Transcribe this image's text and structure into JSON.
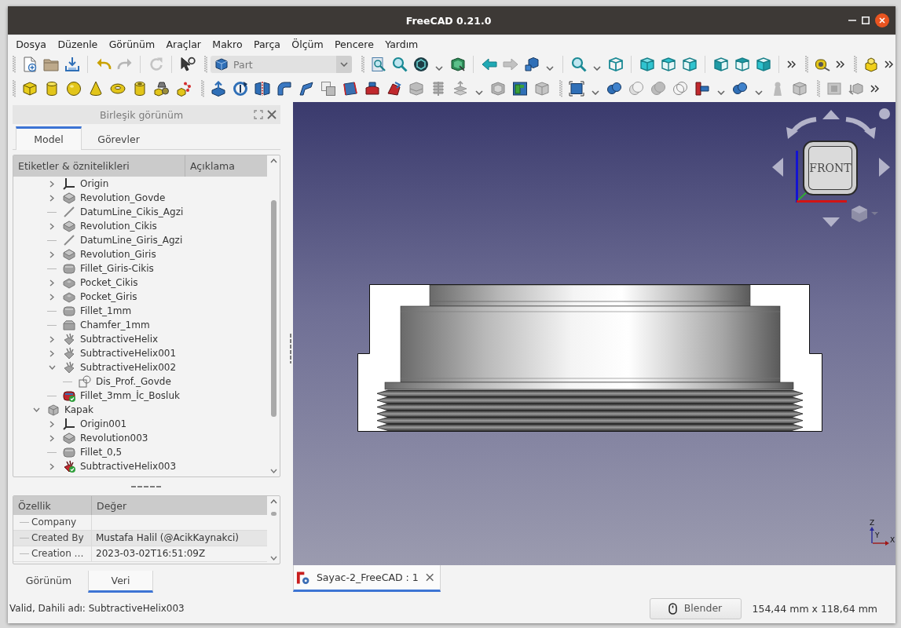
{
  "window": {
    "title": "FreeCAD 0.21.0"
  },
  "menu": [
    "Dosya",
    "Düzenle",
    "Görünüm",
    "Araçlar",
    "Makro",
    "Parça",
    "Ölçüm",
    "Pencere",
    "Yardım"
  ],
  "toolbar": {
    "workbench": "Part"
  },
  "combo_view": {
    "title": "Birleşik görünüm",
    "tabs": [
      {
        "label": "Model",
        "selected": true
      },
      {
        "label": "Görevler",
        "selected": false
      }
    ]
  },
  "tree": {
    "columns": [
      "Etiketler & öznitelikleri",
      "Açıklama"
    ],
    "items": [
      {
        "children": [
          {
            "label": "Origin",
            "kind": "origin",
            "expanded": false
          },
          {
            "label": "Revolution_Govde",
            "kind": "revolution",
            "expanded": false,
            "visible": false
          },
          {
            "label": "DatumLine_Cikis_Agzi",
            "kind": "datumline",
            "visible": false
          },
          {
            "label": "Revolution_Cikis",
            "kind": "revolution",
            "expanded": false,
            "visible": false
          },
          {
            "label": "DatumLine_Giris_Agzi",
            "kind": "datumline",
            "visible": false
          },
          {
            "label": "Revolution_Giris",
            "kind": "revolution",
            "expanded": false,
            "visible": false
          },
          {
            "label": "Fillet_Giris-Cikis",
            "kind": "fillet",
            "visible": false
          },
          {
            "label": "Pocket_Cikis",
            "kind": "pocket",
            "expanded": false,
            "visible": false
          },
          {
            "label": "Pocket_Giris",
            "kind": "pocket",
            "expanded": false,
            "visible": false
          },
          {
            "label": "Fillet_1mm",
            "kind": "fillet",
            "visible": false
          },
          {
            "label": "Chamfer_1mm",
            "kind": "chamfer",
            "visible": false
          },
          {
            "label": "SubtractiveHelix",
            "kind": "helix",
            "expanded": false,
            "visible": false
          },
          {
            "label": "SubtractiveHelix001",
            "kind": "helix",
            "expanded": false,
            "visible": false
          },
          {
            "label": "SubtractiveHelix002",
            "kind": "helix",
            "expanded": true,
            "visible": false,
            "children": [
              {
                "label": "Dis_Prof._Govde",
                "kind": "sketch"
              }
            ]
          },
          {
            "label": "Fillet_3mm_İc_Bosluk",
            "kind": "fillet",
            "visible": true
          }
        ]
      },
      {
        "label": "Kapak",
        "kind": "body",
        "expanded": true,
        "children": [
          {
            "label": "Origin001",
            "kind": "origin",
            "expanded": false
          },
          {
            "label": "Revolution003",
            "kind": "revolution",
            "expanded": false,
            "visible": false
          },
          {
            "label": "Fillet_0,5",
            "kind": "fillet",
            "visible": false
          },
          {
            "label": "SubtractiveHelix003",
            "kind": "helix",
            "expanded": false,
            "visible": true
          }
        ]
      }
    ]
  },
  "properties": {
    "columns": [
      "Özellik",
      "Değer"
    ],
    "rows": [
      {
        "name": "Company"
      },
      {
        "name": "Created By",
        "value": "Mustafa Halil (@AcikKaynakci)"
      },
      {
        "name": "Creation …",
        "value": "2023-03-02T16:51:09Z"
      }
    ]
  },
  "panel_tabs": [
    {
      "label": "Görünüm",
      "selected": false
    },
    {
      "label": "Veri",
      "selected": true
    }
  ],
  "viewport": {
    "nav_cube_face": "FRONT",
    "axis_labels": [
      "Z",
      "Y",
      "X"
    ]
  },
  "document_tabs": [
    {
      "label": "Sayac-2_FreeCAD : 1",
      "selected": true
    }
  ],
  "status_bar": {
    "message": "Valid, Dahili adı: SubtractiveHelix003",
    "navigation_style": "Blender",
    "dimensions": "154,44 mm x 118,64 mm"
  }
}
